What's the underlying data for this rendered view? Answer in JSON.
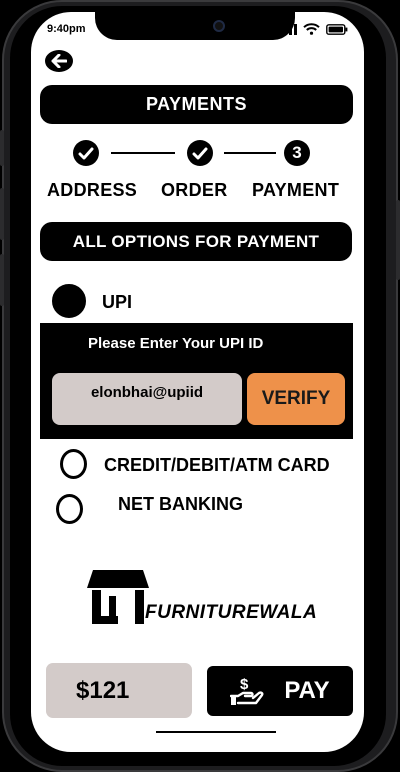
{
  "status_bar": {
    "time": "9:40pm"
  },
  "header": {
    "title": "PAYMENTS"
  },
  "steps": [
    {
      "label": "ADDRESS",
      "state": "done"
    },
    {
      "label": "ORDER",
      "state": "done"
    },
    {
      "label": "PAYMENT",
      "number": "3",
      "state": "current"
    }
  ],
  "options_title": "ALL OPTIONS FOR PAYMENT",
  "payment_options": {
    "upi": {
      "label": "UPI",
      "selected": true
    },
    "card": {
      "label": "CREDIT/DEBIT/ATM CARD",
      "selected": false
    },
    "netbanking": {
      "label": "NET BANKING",
      "selected": false
    }
  },
  "upi_panel": {
    "title": "Please Enter Your UPI ID",
    "upi_id_value": "elonbhai@upiid",
    "verify_label": "VERIFY"
  },
  "brand": {
    "name": "FURNITUREWALA"
  },
  "footer": {
    "price": "$121",
    "pay_label": "PAY"
  },
  "colors": {
    "accent": "#ee914a",
    "input_bg": "#d3cbc9",
    "primary": "#000000"
  }
}
